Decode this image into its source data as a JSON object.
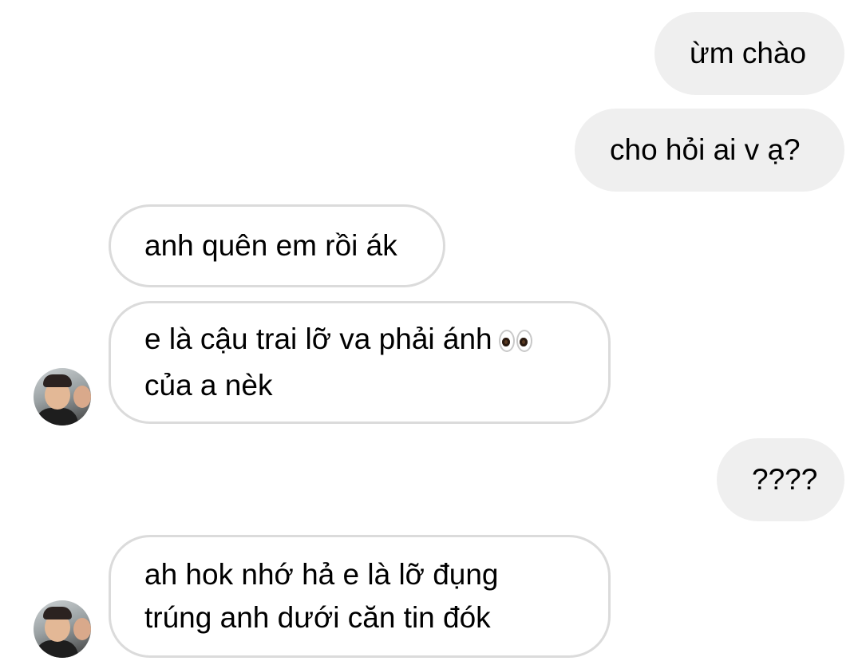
{
  "messages": [
    {
      "direction": "sent",
      "lines": [
        "ừm chào"
      ]
    },
    {
      "direction": "sent",
      "lines": [
        "cho hỏi ai v ạ?"
      ]
    },
    {
      "direction": "received",
      "lines": [
        "anh quên em rồi ák"
      ]
    },
    {
      "direction": "received",
      "lines": [
        "e là cậu trai lỡ va phải ánh",
        "của a nèk"
      ],
      "emoji": "eyes-emoji"
    },
    {
      "direction": "sent",
      "lines": [
        "????"
      ]
    },
    {
      "direction": "received",
      "lines": [
        "ah hok nhớ hả e là lỡ đụng",
        "trúng anh dưới căn tin đók"
      ]
    }
  ],
  "avatars": [
    {
      "icon": "profile-photo"
    },
    {
      "icon": "profile-photo"
    }
  ],
  "colors": {
    "background": "#ffffff",
    "sent_bubble": "#efefef",
    "received_border": "#dbdbdb",
    "text": "#000000"
  }
}
